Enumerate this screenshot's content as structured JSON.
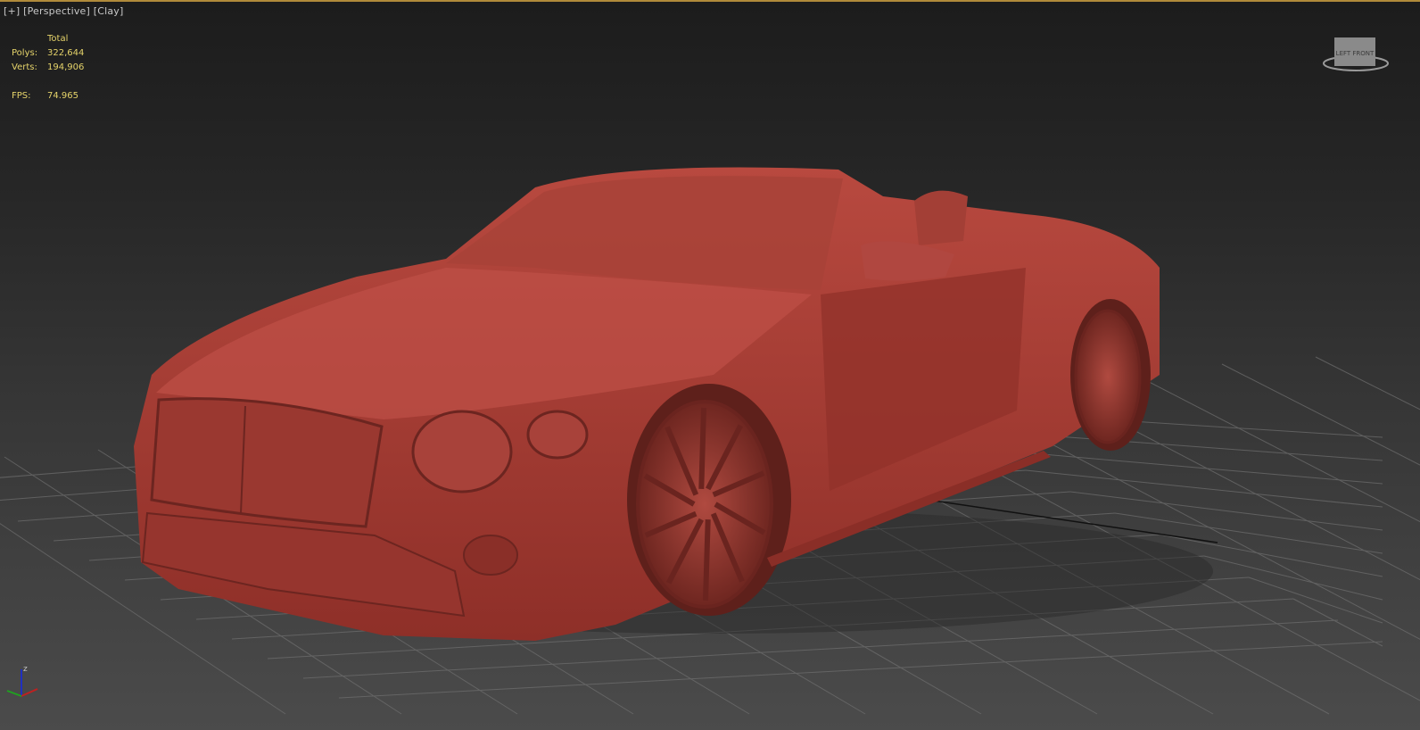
{
  "viewport": {
    "menu_plus": "[+]",
    "view_mode": "[Perspective]",
    "shading_mode": "[Clay]"
  },
  "stats": {
    "header": "Total",
    "polys_label": "Polys:",
    "polys_value": "322,644",
    "verts_label": "Verts:",
    "verts_value": "194,906",
    "fps_label": "FPS:",
    "fps_value": "74.965"
  },
  "viewcube": {
    "face_labels": "LEFT FRONT"
  },
  "axis_gizmo": {
    "z_label": "z"
  },
  "colors": {
    "clay": "#b4463c",
    "stats_text": "#e5d36a",
    "accent_line": "#b08a3a"
  }
}
